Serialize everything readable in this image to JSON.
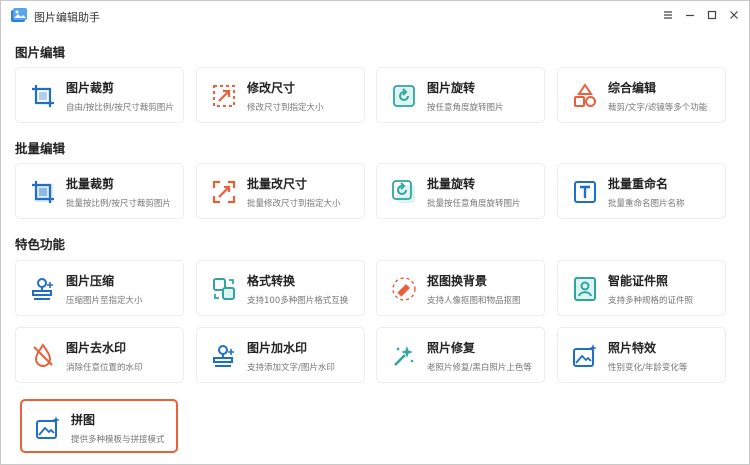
{
  "window": {
    "title": "图片编辑助手",
    "controls": [
      "menu-icon",
      "minimize-icon",
      "maximize-icon",
      "close-icon"
    ]
  },
  "sections": [
    {
      "title": "图片编辑",
      "items": [
        {
          "name": "图片裁剪",
          "desc": "自由/按比例/按尺寸裁剪图片",
          "icon": "crop-icon"
        },
        {
          "name": "修改尺寸",
          "desc": "修改尺寸到指定大小",
          "icon": "resize-icon"
        },
        {
          "name": "图片旋转",
          "desc": "按任意角度旋转图片",
          "icon": "rotate-icon"
        },
        {
          "name": "综合编辑",
          "desc": "裁剪/文字/滤镜等多个功能",
          "icon": "shapes-icon"
        }
      ]
    },
    {
      "title": "批量编辑",
      "items": [
        {
          "name": "批量裁剪",
          "desc": "批量按比例/按尺寸裁剪图片",
          "icon": "batch-crop-icon"
        },
        {
          "name": "批量改尺寸",
          "desc": "批量修改尺寸到指定大小",
          "icon": "batch-resize-icon"
        },
        {
          "name": "批量旋转",
          "desc": "批量按任意角度旋转图片",
          "icon": "batch-rotate-icon"
        },
        {
          "name": "批量重命名",
          "desc": "批量重命名图片名称",
          "icon": "rename-icon"
        }
      ]
    },
    {
      "title": "特色功能",
      "items": [
        {
          "name": "图片压缩",
          "desc": "压缩图片至指定大小",
          "icon": "stamp-icon"
        },
        {
          "name": "格式转换",
          "desc": "支持100多种图片格式互换",
          "icon": "convert-icon"
        },
        {
          "name": "抠图换背景",
          "desc": "支持人像抠图和物品抠图",
          "icon": "eraser-icon"
        },
        {
          "name": "智能证件照",
          "desc": "支持多种规格的证件照",
          "icon": "id-photo-icon"
        },
        {
          "name": "图片去水印",
          "desc": "消除任意位置的水印",
          "icon": "drop-icon"
        },
        {
          "name": "图片加水印",
          "desc": "支持添加文字/图片水印",
          "icon": "watermark-icon"
        },
        {
          "name": "照片修复",
          "desc": "老照片修复/黑白照片上色等",
          "icon": "magic-wand-icon"
        },
        {
          "name": "照片特效",
          "desc": "性别变化/年龄变化等",
          "icon": "image-sparkle-icon"
        },
        {
          "name": "拼图",
          "desc": "提供多种模板与拼接模式",
          "icon": "collage-icon",
          "selected": true
        }
      ]
    }
  ],
  "colors": {
    "blue": "#1f6fc5",
    "orange": "#e8613a",
    "teal": "#2fa5a0",
    "selected_border": "#e8613a"
  }
}
